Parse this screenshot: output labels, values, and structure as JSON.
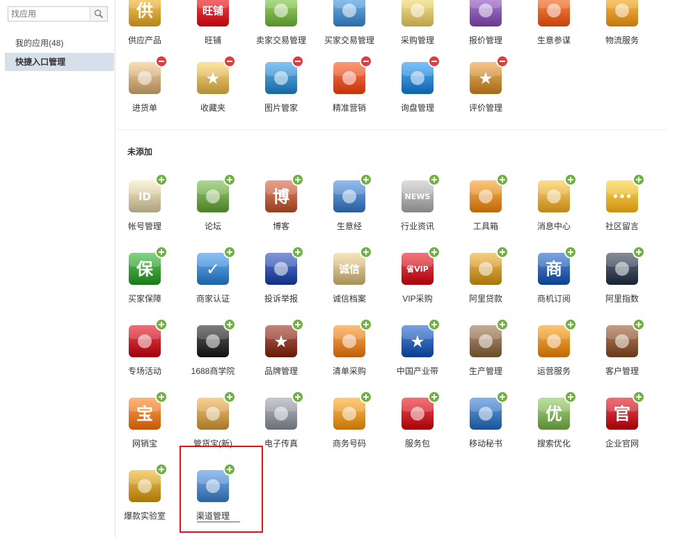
{
  "search": {
    "placeholder": "找应用"
  },
  "sidebar": {
    "items": [
      {
        "label": "我的应用(48)"
      },
      {
        "label": "快捷入口管理"
      }
    ]
  },
  "section": {
    "not_added_title": "未添加"
  },
  "added_apps": [
    {
      "label": "供应产品",
      "icon": "supply-products-icon",
      "glyph": "供",
      "color": "#d9a53c"
    },
    {
      "label": "旺铺",
      "icon": "wangpu-shop-icon",
      "glyph": "旺铺",
      "color": "#d9272e"
    },
    {
      "label": "卖家交易管理",
      "icon": "seller-cart-icon",
      "glyph": "",
      "color": "#7ab34b"
    },
    {
      "label": "买家交易管理",
      "icon": "buyer-cart-icon",
      "glyph": "",
      "color": "#4f8fc9"
    },
    {
      "label": "采购管理",
      "icon": "purchase-folder-icon",
      "glyph": "",
      "color": "#e0c36d"
    },
    {
      "label": "报价管理",
      "icon": "puzzle-icon",
      "glyph": "",
      "color": "#8a5bb0"
    },
    {
      "label": "生意参谋",
      "icon": "compass-icon",
      "glyph": "",
      "color": "#e8652b"
    },
    {
      "label": "物流服务",
      "icon": "truck-icon",
      "glyph": "",
      "color": "#e89a2c"
    },
    {
      "label": "进货单",
      "icon": "clipboard-icon",
      "glyph": "",
      "color": "#caa877"
    },
    {
      "label": "收藏夹",
      "icon": "star-folder-icon",
      "glyph": "★",
      "color": "#d9b05a"
    },
    {
      "label": "图片管家",
      "icon": "picture-frame-icon",
      "glyph": "",
      "color": "#3a8bc4"
    },
    {
      "label": "精准营销",
      "icon": "target-icon",
      "glyph": "",
      "color": "#e8552b"
    },
    {
      "label": "询盘管理",
      "icon": "globe-icon",
      "glyph": "",
      "color": "#2f86cf"
    },
    {
      "label": "评价管理",
      "icon": "star-rating-icon",
      "glyph": "★",
      "color": "#c78b3c"
    }
  ],
  "unadded_apps": [
    {
      "label": "帐号管理",
      "icon": "id-card-icon",
      "glyph": "ID",
      "color": "#cfc4a2"
    },
    {
      "label": "论坛",
      "icon": "forum-people-icon",
      "glyph": "",
      "color": "#6da24a"
    },
    {
      "label": "博客",
      "icon": "blog-icon",
      "glyph": "博",
      "color": "#b95f42"
    },
    {
      "label": "生意经",
      "icon": "book-icon",
      "glyph": "",
      "color": "#4a7fc0"
    },
    {
      "label": "行业资讯",
      "icon": "news-icon",
      "glyph": "NEWS",
      "color": "#a9a9a9"
    },
    {
      "label": "工具箱",
      "icon": "toolbox-icon",
      "glyph": "",
      "color": "#e08a2a"
    },
    {
      "label": "消息中心",
      "icon": "megaphone-icon",
      "glyph": "",
      "color": "#e3a93e"
    },
    {
      "label": "社区留言",
      "icon": "chat-bubble-icon",
      "glyph": "•••",
      "color": "#f2b233"
    },
    {
      "label": "买家保障",
      "icon": "shield-icon",
      "glyph": "保",
      "color": "#3a9d3a"
    },
    {
      "label": "商家认证",
      "icon": "verified-shield-icon",
      "glyph": "✓",
      "color": "#3f86c8"
    },
    {
      "label": "投诉举报",
      "icon": "alarm-light-icon",
      "glyph": "",
      "color": "#3451a8"
    },
    {
      "label": "诚信档案",
      "icon": "envelope-icon",
      "glyph": "诚信",
      "color": "#c9b37e"
    },
    {
      "label": "VIP采购",
      "icon": "vip-card-icon",
      "glyph": "省VIP",
      "color": "#c8262c"
    },
    {
      "label": "阿里贷款",
      "icon": "coin-icon",
      "glyph": "",
      "color": "#c9962f"
    },
    {
      "label": "商机订阅",
      "icon": "mail-stamp-icon",
      "glyph": "商",
      "color": "#2e63b3"
    },
    {
      "label": "阿里指数",
      "icon": "trend-chart-icon",
      "glyph": "",
      "color": "#3a4656"
    },
    {
      "label": "专场活动",
      "icon": "stage-curtain-icon",
      "glyph": "",
      "color": "#c31f2a"
    },
    {
      "label": "1688商学院",
      "icon": "graduation-cap-icon",
      "glyph": "",
      "color": "#333333"
    },
    {
      "label": "品牌管理",
      "icon": "brand-star-icon",
      "glyph": "★",
      "color": "#8a3b2a"
    },
    {
      "label": "清单采购",
      "icon": "shopping-basket-icon",
      "glyph": "",
      "color": "#e2822b"
    },
    {
      "label": "中国产业带",
      "icon": "map-pin-icon",
      "glyph": "★",
      "color": "#2b5fb0"
    },
    {
      "label": "生产管理",
      "icon": "machine-icon",
      "glyph": "",
      "color": "#8c6d4d"
    },
    {
      "label": "运营服务",
      "icon": "service-person-icon",
      "glyph": "",
      "color": "#e48a1f"
    },
    {
      "label": "客户管理",
      "icon": "customer-card-icon",
      "glyph": "",
      "color": "#8a5a3a"
    },
    {
      "label": "网销宝",
      "icon": "wangxiaobao-icon",
      "glyph": "宝",
      "color": "#e9792a"
    },
    {
      "label": "管货宝(新)",
      "icon": "goods-box-icon",
      "glyph": "",
      "color": "#c99a4b"
    },
    {
      "label": "电子传真",
      "icon": "fax-printer-icon",
      "glyph": "",
      "color": "#8d9199"
    },
    {
      "label": "商务号码",
      "icon": "phone-icon",
      "glyph": "",
      "color": "#e8952a"
    },
    {
      "label": "服务包",
      "icon": "gift-box-icon",
      "glyph": "",
      "color": "#c8232a"
    },
    {
      "label": "移动秘书",
      "icon": "mobile-icon",
      "glyph": "",
      "color": "#3d76b8"
    },
    {
      "label": "搜索优化",
      "icon": "seo-magnifier-icon",
      "glyph": "优",
      "color": "#7fae58"
    },
    {
      "label": "企业官网",
      "icon": "official-site-shield-icon",
      "glyph": "官",
      "color": "#c2222a"
    },
    {
      "label": "爆款实验室",
      "icon": "key-icon",
      "glyph": "",
      "color": "#c99a2a"
    },
    {
      "label": "渠道管理",
      "icon": "handshake-icon",
      "glyph": "",
      "color": "#4f86c2"
    }
  ]
}
